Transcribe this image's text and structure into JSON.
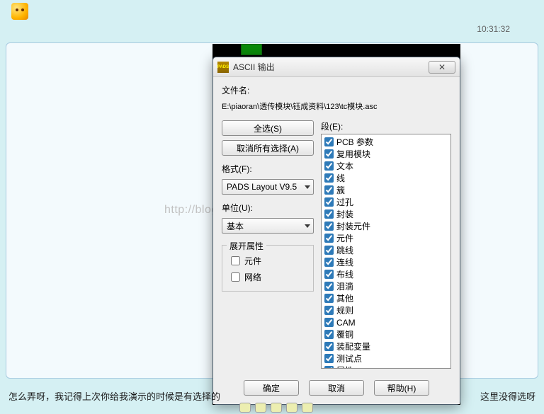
{
  "chat": {
    "timestamp": "10:31:32",
    "blog_watermark": "http://blog.csdn",
    "bottom_text_left": "怎么弄呀，我记得上次你给我演示的时候是有选择的",
    "bottom_text_right": "这里没得选呀"
  },
  "dialog": {
    "title": "ASCII 输出",
    "app_icon_text": "PADS",
    "close_glyph": "✕",
    "filename_label": "文件名:",
    "filename_path": "E:\\piaoran\\透传模块\\钰成资料\\123\\tc模块.asc",
    "select_all_btn": "全选(S)",
    "unselect_all_btn": "取消所有选择(A)",
    "format_label": "格式(F):",
    "format_value": "PADS Layout V9.5",
    "units_label": "单位(U):",
    "units_value": "基本",
    "expand_group_label": "展开属性",
    "expand_component_label": "元件",
    "expand_net_label": "网络",
    "sections_label": "段(E):",
    "sections": [
      "PCB 参数",
      "复用模块",
      "文本",
      "线",
      "簇",
      "过孔",
      "封装",
      "封装元件",
      "元件",
      "跳线",
      "连线",
      "布线",
      "泪滴",
      "其他",
      "规则",
      "CAM",
      "覆铜",
      "装配变量",
      "测试点",
      "属性"
    ],
    "ok_btn": "确定",
    "cancel_btn": "取消",
    "help_btn": "帮助(H)"
  }
}
